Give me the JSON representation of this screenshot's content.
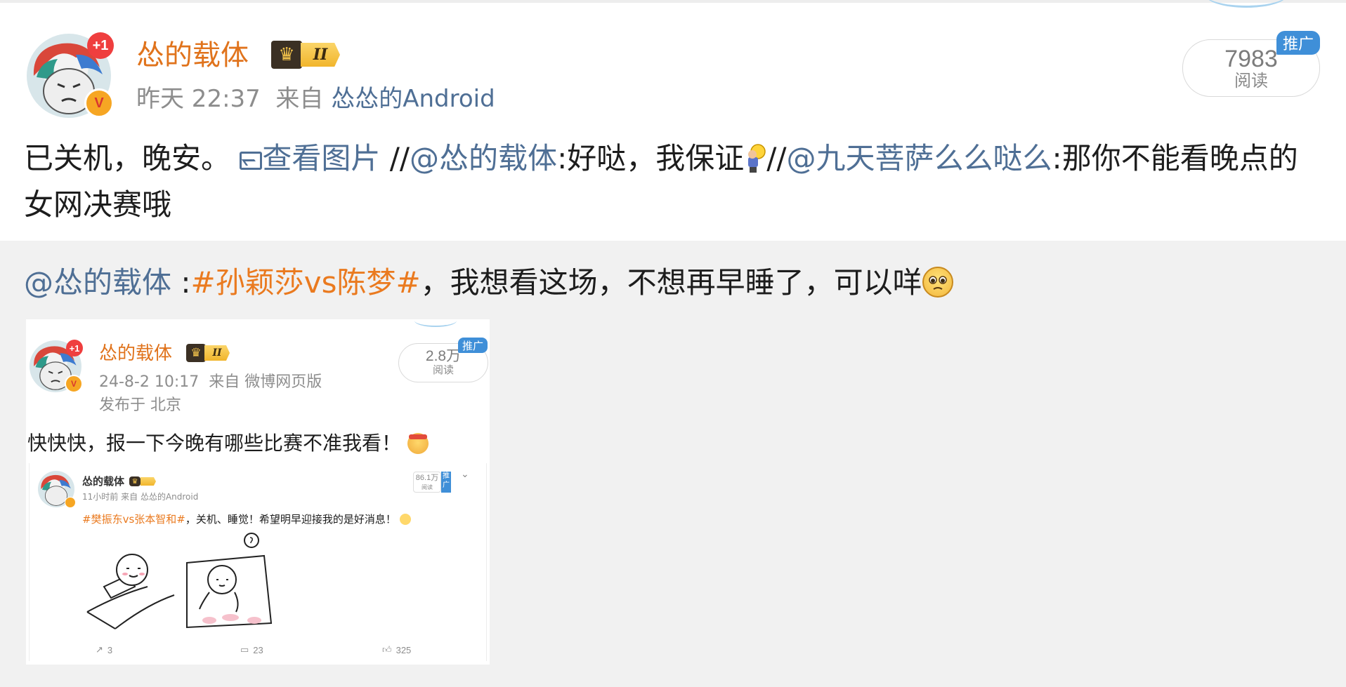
{
  "post": {
    "author": "怂的载体",
    "avatar_plus": "+1",
    "verified_mark": "V",
    "level": "II",
    "time": "昨天 22:37",
    "source_prefix": "来自",
    "source": "怂怂的Android",
    "read_count": "7983",
    "read_label": "阅读",
    "promo_label": "推广",
    "text_start": "已关机，晚安。",
    "view_image_label": "查看图片",
    "sep1": " //",
    "mention1": "@怂的载体",
    "text_mid": ":好哒，我保证",
    "sep2": "//",
    "mention2": "@九天菩萨么么哒么",
    "text_end": ":那你不能看晚点的女网决赛哦",
    "emoji_bulb": "bulb-emoji"
  },
  "repost": {
    "mention": "@怂的载体",
    "colon": " :",
    "hashtag": "#孙颖莎vs陈梦#",
    "text": "，我想看这场，不想再早睡了，可以咩",
    "emoji": "pleading-face-emoji"
  },
  "embed": {
    "author": "怂的载体",
    "avatar_plus": "+1",
    "verified_mark": "V",
    "level": "II",
    "time": "24-8-2 10:17",
    "source_prefix": "来自",
    "source": "微博网页版",
    "location": "发布于 北京",
    "read_count": "2.8万",
    "read_label": "阅读",
    "promo_label": "推广",
    "text": "快快快，报一下今晚有哪些比赛不准我看！"
  },
  "inner": {
    "author": "怂的载体",
    "time": "11小时前",
    "source_prefix": "来自",
    "source": "怂怂的Android",
    "read_count": "86.1万",
    "read_label": "阅读",
    "promo_label": "推广",
    "hashtag": "#樊振东vs张本智和#",
    "text": "，关机、睡觉！希望明早迎接我的是好消息！",
    "reposts": "3",
    "comments": "23",
    "likes": "325"
  },
  "colors": {
    "link": "#4f6f95",
    "hashtag": "#ea7a1f",
    "username": "#e0731c",
    "promo": "#3f8fd8"
  }
}
